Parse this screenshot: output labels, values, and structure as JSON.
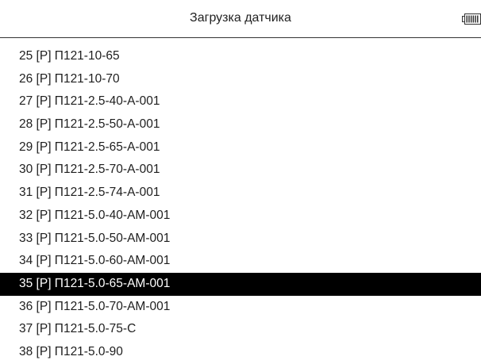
{
  "header": {
    "title": "Загрузка датчика",
    "battery_icon": "battery-icon"
  },
  "sensor_list": {
    "selected_index": 10,
    "items": [
      "25 [P]  П121-10-65",
      "26 [P]  П121-10-70",
      "27 [P]  П121-2.5-40-А-001",
      "28 [P]  П121-2.5-50-А-001",
      "29 [P]  П121-2.5-65-А-001",
      "30 [P]  П121-2.5-70-А-001",
      "31 [P]  П121-2.5-74-А-001",
      "32 [P]  П121-5.0-40-АМ-001",
      "33 [P]  П121-5.0-50-АМ-001",
      "34 [P]  П121-5.0-60-АМ-001",
      "35 [P]  П121-5.0-65-АМ-001",
      "36 [P]  П121-5.0-70-АМ-001",
      "37 [P]  П121-5.0-75-С",
      "38 [P]  П121-5.0-90"
    ]
  }
}
